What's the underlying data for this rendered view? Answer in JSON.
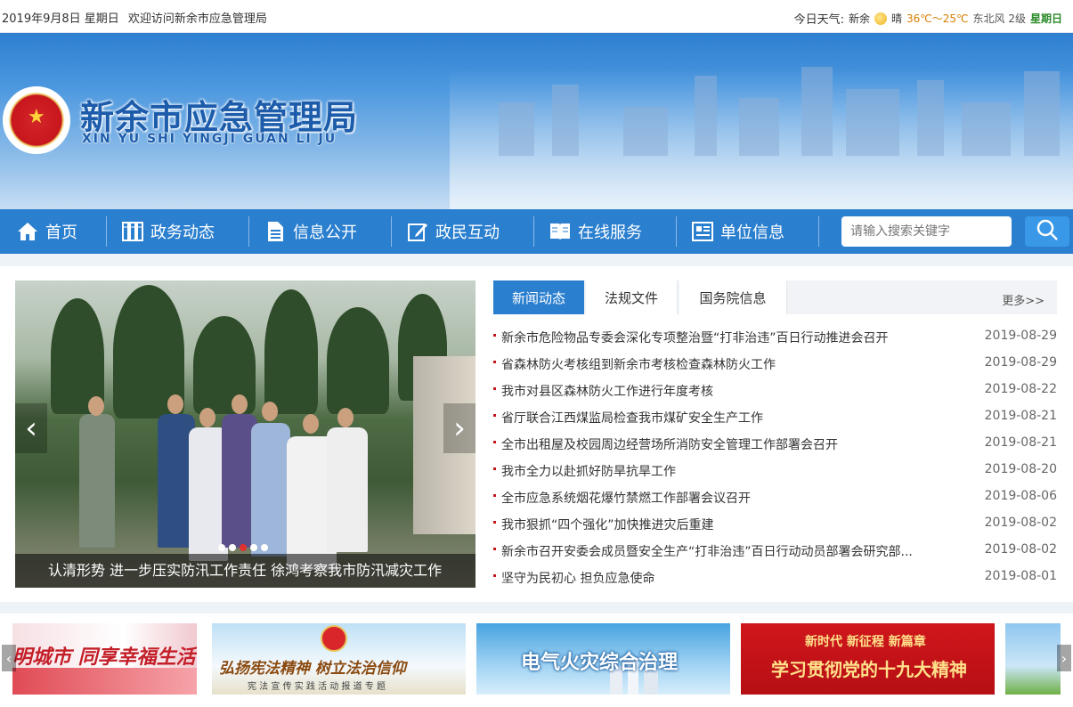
{
  "topbar": {
    "date": "2019年9月8日 星期日",
    "welcome": "欢迎访问新余市应急管理局",
    "weather_label": "今日天气:",
    "city": "新余",
    "condition": "晴",
    "temp": "36℃～25℃",
    "wind": "东北风 2级",
    "weekday": "星期日"
  },
  "header": {
    "title": "新余市应急管理局",
    "subtitle": "XIN YU SHI YINGJI GUAN LI JU",
    "emblem_icon": "national-emblem-icon"
  },
  "nav": {
    "items": [
      {
        "label": "首页",
        "icon": "home-icon"
      },
      {
        "label": "政务动态",
        "icon": "document-stack-icon"
      },
      {
        "label": "信息公开",
        "icon": "document-icon"
      },
      {
        "label": "政民互动",
        "icon": "edit-icon"
      },
      {
        "label": "在线服务",
        "icon": "book-icon"
      },
      {
        "label": "单位信息",
        "icon": "info-board-icon"
      }
    ],
    "search_placeholder": "请输入搜索关键字",
    "search_icon": "search-icon"
  },
  "slider": {
    "caption": "认清形势 进一步压实防汛工作责任 徐鸿考察我市防汛减灾工作",
    "slide_count": 5,
    "active_slide": 3
  },
  "tabs": {
    "items": [
      "新闻动态",
      "法规文件",
      "国务院信息"
    ],
    "active": 0,
    "more": "更多>>"
  },
  "news": [
    {
      "title": "新余市危险物品专委会深化专项整治暨“打非治违”百日行动推进会召开",
      "date": "2019-08-29"
    },
    {
      "title": "省森林防火考核组到新余市考核检查森林防火工作",
      "date": "2019-08-29"
    },
    {
      "title": "我市对县区森林防火工作进行年度考核",
      "date": "2019-08-22"
    },
    {
      "title": "省厅联合江西煤监局检查我市煤矿安全生产工作",
      "date": "2019-08-21"
    },
    {
      "title": "全市出租屋及校园周边经营场所消防安全管理工作部署会召开",
      "date": "2019-08-21"
    },
    {
      "title": "我市全力以赴抓好防旱抗旱工作",
      "date": "2019-08-20"
    },
    {
      "title": "全市应急系统烟花爆竹禁燃工作部署会议召开",
      "date": "2019-08-06"
    },
    {
      "title": "我市狠抓“四个强化”加快推进灾后重建",
      "date": "2019-08-02"
    },
    {
      "title": "新余市召开安委会成员暨安全生产“打非治违”百日行动动员部署会研究部...",
      "date": "2019-08-02"
    },
    {
      "title": "坚守为民初心 担负应急使命",
      "date": "2019-08-01"
    }
  ],
  "banners": [
    {
      "text": "明城市 同享幸福生活"
    },
    {
      "text": "弘扬宪法精神 树立法治信仰",
      "sub": "宪 法 宣 传 实 践 活 动 报 道 专 题"
    },
    {
      "text": "电气火灾综合治理"
    },
    {
      "text": "学习贯彻党的十九大精神",
      "sub": "新时代 新征程 新篇章"
    }
  ],
  "colors": {
    "primary": "#2b7fcf",
    "accent_red": "#c5161d",
    "page_bg": "#eef3f8"
  }
}
